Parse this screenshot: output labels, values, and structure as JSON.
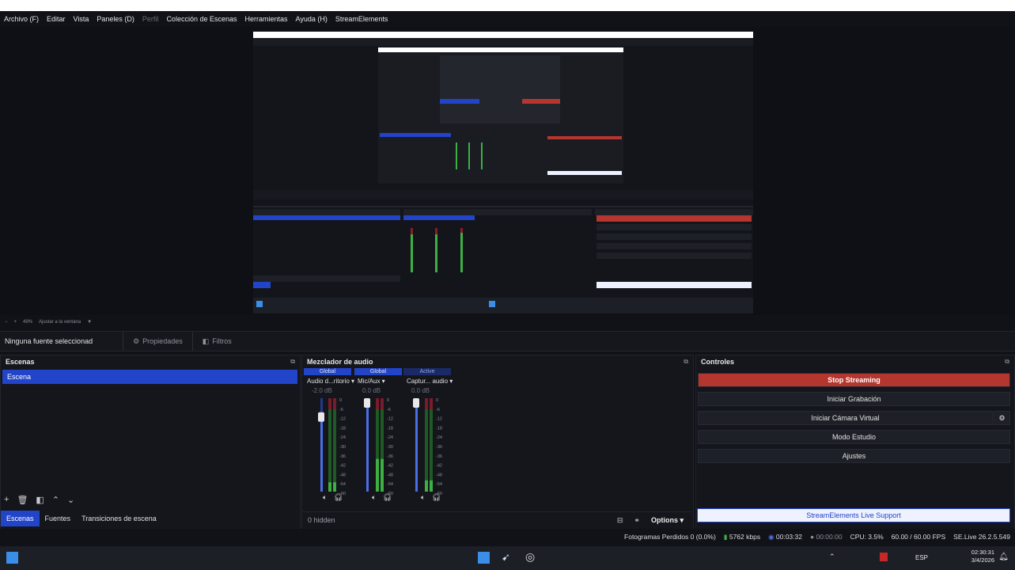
{
  "menu": [
    "Archivo (F)",
    "Editar",
    "Vista",
    "Paneles (D)",
    "Perfil",
    "Colección de Escenas",
    "Herramientas",
    "Ayuda (H)",
    "StreamElements"
  ],
  "zoom": {
    "percent": "49%",
    "fit_label": "Ajustar a la ventana"
  },
  "source_bar": {
    "no_source": "Ninguna fuente seleccionad",
    "properties": "Propiedades",
    "filters": "Filtros"
  },
  "scenes": {
    "title": "Escenas",
    "items": [
      "Escena"
    ],
    "tabs": [
      "Escenas",
      "Fuentes",
      "Transiciones de escena"
    ]
  },
  "mixer": {
    "title": "Mezclador de audio",
    "channels": [
      {
        "header": "Global",
        "name": "Audio d...ritorio",
        "db": "-2.0 dB",
        "fader": 0.85,
        "level": 0.1
      },
      {
        "header": "Global",
        "name": "Mic/Aux",
        "db": "0.0 dB",
        "fader": 1.0,
        "level": 0.35
      },
      {
        "header": "Active",
        "name": "Captur... audio",
        "db": "0.0 dB",
        "fader": 1.0,
        "level": 0.12
      }
    ],
    "scale": [
      "0",
      "-6",
      "-12",
      "-18",
      "-24",
      "-30",
      "-36",
      "-42",
      "-48",
      "-54",
      "-60"
    ],
    "hidden_label": "0 hidden",
    "options_label": "Options"
  },
  "controls": {
    "title": "Controles",
    "buttons": [
      "Stop Streaming",
      "Iniciar Grabación",
      "Iniciar Cámara Virtual",
      "Modo Estudio",
      "Ajustes"
    ],
    "live_support": "StreamElements Live Support"
  },
  "status": {
    "dropped": "Fotogramas Perdidos 0 (0.0%)",
    "bitrate": "5762 kbps",
    "stream_time": "00:03:32",
    "rec_time": "00:00:00",
    "cpu": "CPU: 3.5%",
    "fps": "60.00 / 60.00 FPS",
    "version": "SE.Live 26.2.5.549"
  },
  "taskbar": {
    "lang": "ESP",
    "time": "02:30:31",
    "date": "3/4/2026"
  },
  "colors": {
    "accent": "#2244c8",
    "stop": "#b4362e",
    "bg": "#101218"
  }
}
